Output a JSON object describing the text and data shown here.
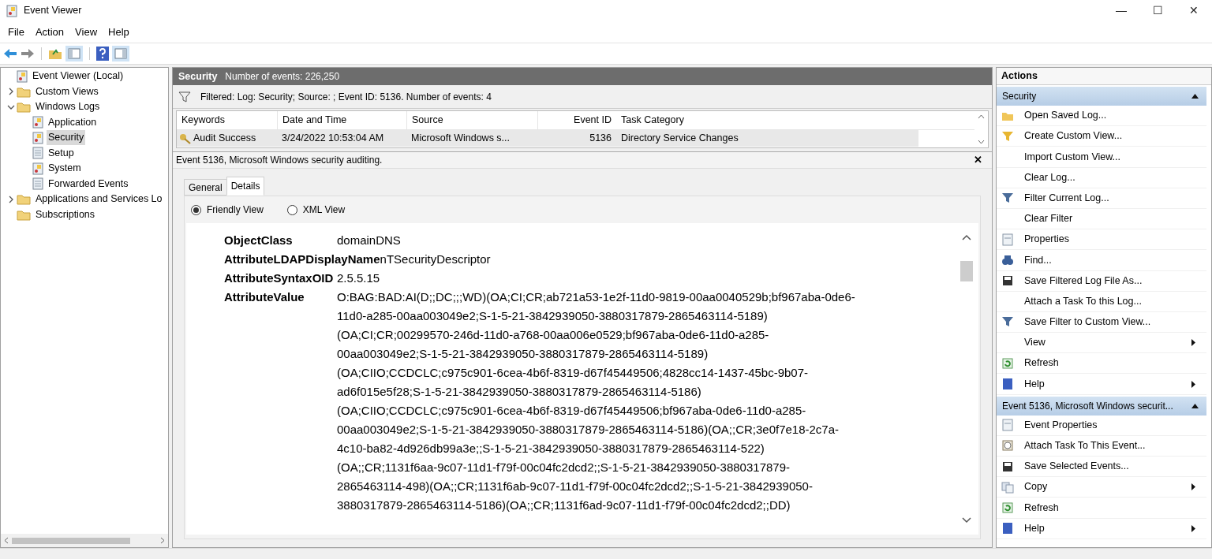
{
  "window": {
    "title": "Event Viewer",
    "controls": [
      "—",
      "☐",
      "✕"
    ]
  },
  "menu": [
    "File",
    "Action",
    "View",
    "Help"
  ],
  "tree": [
    {
      "label": "Event Viewer (Local)",
      "selected": false
    },
    {
      "label": "Custom Views",
      "selected": false,
      "expanded": false
    },
    {
      "label": "Windows Logs",
      "selected": false,
      "expanded": true,
      "children": [
        {
          "label": "Application",
          "selected": false
        },
        {
          "label": "Security",
          "selected": true
        },
        {
          "label": "Setup",
          "selected": false
        },
        {
          "label": "System",
          "selected": false
        },
        {
          "label": "Forwarded Events",
          "selected": false
        }
      ]
    },
    {
      "label": "Applications and Services Lo",
      "selected": false,
      "expanded": false
    },
    {
      "label": "Subscriptions",
      "selected": false
    }
  ],
  "log_header": {
    "title": "Security",
    "count": "Number of events: 226,250"
  },
  "filter_bar": "Filtered: Log: Security; Source: ; Event ID: 5136. Number of events: 4",
  "table": {
    "columns": [
      "Keywords",
      "Date and Time",
      "Source",
      "Event ID",
      "Task Category"
    ],
    "rows": [
      {
        "selected": true,
        "cells": [
          "Audit Success",
          "3/24/2022 10:53:04 AM",
          "Microsoft Windows s...",
          "5136",
          "Directory Service Changes"
        ]
      }
    ]
  },
  "detail": {
    "title": "Event 5136, Microsoft Windows security auditing.",
    "close": "✕",
    "tabs": [
      {
        "label": "General",
        "selected": false
      },
      {
        "label": "Details",
        "selected": true
      }
    ],
    "views": [
      {
        "label": "Friendly View",
        "selected": true
      },
      {
        "label": "XML View",
        "selected": false
      }
    ],
    "fields": [
      {
        "name": "ObjectClass",
        "value": [
          "domainDNS"
        ]
      },
      {
        "name": "AttributeLDAPDisplayName",
        "value": [
          "nTSecurityDescriptor"
        ]
      },
      {
        "name": "AttributeSyntaxOID",
        "value": [
          "2.5.5.15"
        ]
      },
      {
        "name": "AttributeValue",
        "value": [
          "O:BAG:BAD:AI(D;;DC;;;WD)(OA;CI;CR;ab721a53-1e2f-11d0-9819-00aa0040529b;bf967aba-0de6-",
          "11d0-a285-00aa003049e2;S-1-5-21-3842939050-3880317879-2865463114-5189)",
          "(OA;CI;CR;00299570-246d-11d0-a768-00aa006e0529;bf967aba-0de6-11d0-a285-",
          "00aa003049e2;S-1-5-21-3842939050-3880317879-2865463114-5189)",
          "(OA;CIIO;CCDCLC;c975c901-6cea-4b6f-8319-d67f45449506;4828cc14-1437-45bc-9b07-",
          "ad6f015e5f28;S-1-5-21-3842939050-3880317879-2865463114-5186)",
          "(OA;CIIO;CCDCLC;c975c901-6cea-4b6f-8319-d67f45449506;bf967aba-0de6-11d0-a285-",
          "00aa003049e2;S-1-5-21-3842939050-3880317879-2865463114-5186)(OA;;CR;3e0f7e18-2c7a-",
          "4c10-ba82-4d926db99a3e;;S-1-5-21-3842939050-3880317879-2865463114-522)",
          "(OA;;CR;1131f6aa-9c07-11d1-f79f-00c04fc2dcd2;;S-1-5-21-3842939050-3880317879-",
          "2865463114-498)(OA;;CR;1131f6ab-9c07-11d1-f79f-00c04fc2dcd2;;S-1-5-21-3842939050-",
          "3880317879-2865463114-5186)(OA;;CR;1131f6ad-9c07-11d1-f79f-00c04fc2dcd2;;DD)"
        ]
      }
    ]
  },
  "actions": {
    "title": "Actions",
    "sections": [
      {
        "title": "Security",
        "expanded": true,
        "items": [
          {
            "label": "Open Saved Log...",
            "submenu": false
          },
          {
            "label": "Create Custom View...",
            "submenu": false
          },
          {
            "label": "Import Custom View...",
            "submenu": false
          },
          {
            "label": "Clear Log...",
            "submenu": false
          },
          {
            "label": "Filter Current Log...",
            "submenu": false
          },
          {
            "label": "Clear Filter",
            "submenu": false
          },
          {
            "label": "Properties",
            "submenu": false
          },
          {
            "label": "Find...",
            "submenu": false
          },
          {
            "label": "Save Filtered Log File As...",
            "submenu": false
          },
          {
            "label": "Attach a Task To this Log...",
            "submenu": false
          },
          {
            "label": "Save Filter to Custom View...",
            "submenu": false
          },
          {
            "label": "View",
            "submenu": true
          },
          {
            "label": "Refresh",
            "submenu": false
          },
          {
            "label": "Help",
            "submenu": true
          }
        ]
      },
      {
        "title": "Event 5136, Microsoft Windows securit...",
        "expanded": true,
        "items": [
          {
            "label": "Event Properties",
            "submenu": false
          },
          {
            "label": "Attach Task To This Event...",
            "submenu": false
          },
          {
            "label": "Save Selected Events...",
            "submenu": false
          },
          {
            "label": "Copy",
            "submenu": true
          },
          {
            "label": "Refresh",
            "submenu": false
          },
          {
            "label": "Help",
            "submenu": true
          }
        ]
      }
    ]
  }
}
